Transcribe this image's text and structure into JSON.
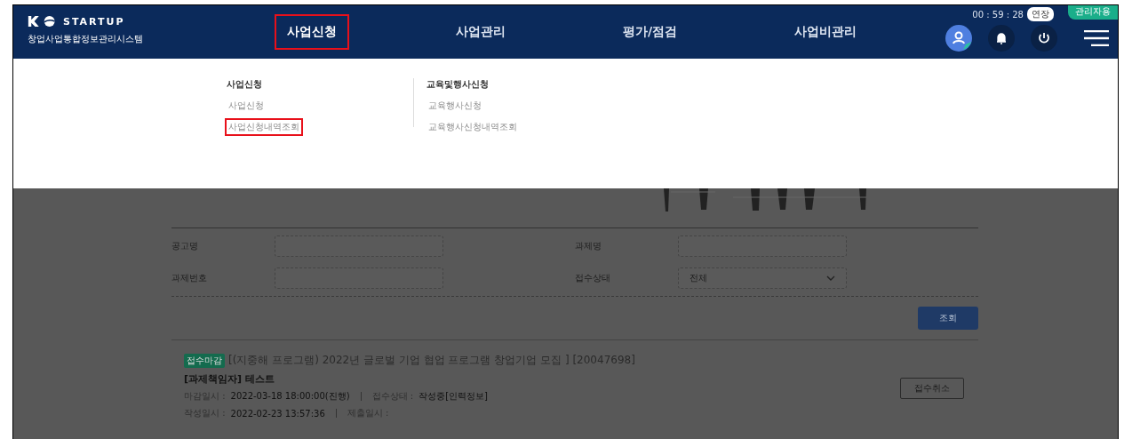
{
  "header": {
    "logo_text": "STARTUP",
    "system_name": "창업사업통합정보관리시스템",
    "nav": [
      {
        "label": "사업신청",
        "selected": true,
        "highlighted": true
      },
      {
        "label": "사업관리",
        "selected": false,
        "highlighted": false
      },
      {
        "label": "평가/점검",
        "selected": false,
        "highlighted": false
      },
      {
        "label": "사업비관리",
        "selected": false,
        "highlighted": false
      }
    ],
    "timer": "00 : 59 : 28",
    "extend_button": "연장",
    "admin_button": "관리자용"
  },
  "dropdown": {
    "groups": [
      {
        "title": "사업신청",
        "links": [
          {
            "label": "사업신청",
            "highlighted": false
          },
          {
            "label": "사업신청내역조회",
            "highlighted": true
          }
        ]
      },
      {
        "title": "교육및행사신청",
        "links": [
          {
            "label": "교육행사신청",
            "highlighted": false
          },
          {
            "label": "교육행사신청내역조회",
            "highlighted": false
          }
        ]
      }
    ]
  },
  "search": {
    "fields": [
      {
        "label": "공고명",
        "kind": "text"
      },
      {
        "label": "과제명",
        "kind": "text"
      },
      {
        "label": "과제번호",
        "kind": "text"
      },
      {
        "label": "접수상태",
        "kind": "select",
        "value": "전체"
      }
    ],
    "button": "조회"
  },
  "result": {
    "badge": "접수마감",
    "title": "[(지중해 프로그램) 2022년 글로벌 기업 협업 프로그램 창업기업 모집 ] [20047698]",
    "subtitle": "[과제책임자] 테스트",
    "details": [
      [
        {
          "label": "마감일시 :",
          "value": "2022-03-18 18:00:00(진행)"
        },
        {
          "label": "접수상태 :",
          "value": "작성중[인력정보]"
        }
      ],
      [
        {
          "label": "작성일시 :",
          "value": "2022-02-23 13:57:36"
        },
        {
          "label": "제출일시 :"
        }
      ]
    ],
    "cancel_button": "접수취소"
  }
}
